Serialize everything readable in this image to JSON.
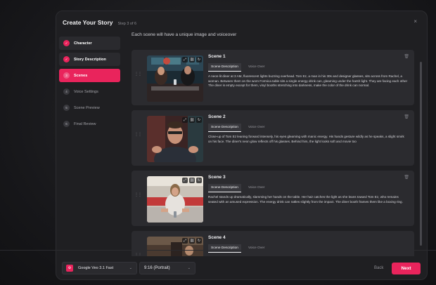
{
  "modal": {
    "title": "Create Your Story",
    "step_label": "Step 3 of 6",
    "close_glyph": "×"
  },
  "sidebar": {
    "steps": [
      {
        "label": "Character",
        "badge": "✓",
        "state": "done"
      },
      {
        "label": "Story Description",
        "badge": "✓",
        "state": "done"
      },
      {
        "label": "Scenes",
        "badge": "3",
        "state": "active"
      },
      {
        "label": "Voice Settings",
        "badge": "4",
        "state": "upcoming"
      },
      {
        "label": "Scene Preview",
        "badge": "5",
        "state": "upcoming"
      },
      {
        "label": "Final Review",
        "badge": "6",
        "state": "upcoming"
      }
    ]
  },
  "main": {
    "subtitle": "Each scene will have a unique image and voiceover",
    "tab_labels": [
      "Scene Description",
      "Voice Over"
    ],
    "scenes": [
      {
        "title": "Scene 1",
        "description": "A neon-lit diner at 3 AM, fluorescent lights buzzing overhead. Tom Ez, a man in his 30s and designer glasses, sits across from Rachel, a woman. Between them on the worn Formica table sits a single energy drink can, gleaming under the harsh light. They are facing each other The diner is empty except for them, vinyl booths stretching into darkness, make the color of the drink can normal."
      },
      {
        "title": "Scene 2",
        "description": "Close-up of Tom Ez leaning forward intensely, his eyes gleaming with manic energy. His hands gesture wildly as he speaks, a slight smirk on his face. The diner's neon glow reflects off his glasses. Behind him, the light looks soft and movie too"
      },
      {
        "title": "Scene 3",
        "description": "Rachel stands up dramatically, slamming her hands on the table. Her hair catches the light as she leans toward Tom Ez, who remains seated with an amused expression. The energy drink can rattles slightly from the impact. The diner booth frames them like a boxing ring."
      },
      {
        "title": "Scene 4",
        "description": ""
      }
    ]
  },
  "footer": {
    "model_label": "Google Veo 3.1 Fast",
    "aspect_ratio": "9:16 (Portrait)",
    "back_label": "Back",
    "next_label": "Next"
  },
  "colors": {
    "accent": "#e9245c",
    "panel": "#1f1f22",
    "card": "#2b2b2f"
  },
  "icons": {
    "thumb_tools": [
      "expand-icon",
      "link-icon",
      "regenerate-icon"
    ],
    "drag": "drag-handle-icon",
    "delete": "trash-icon"
  }
}
